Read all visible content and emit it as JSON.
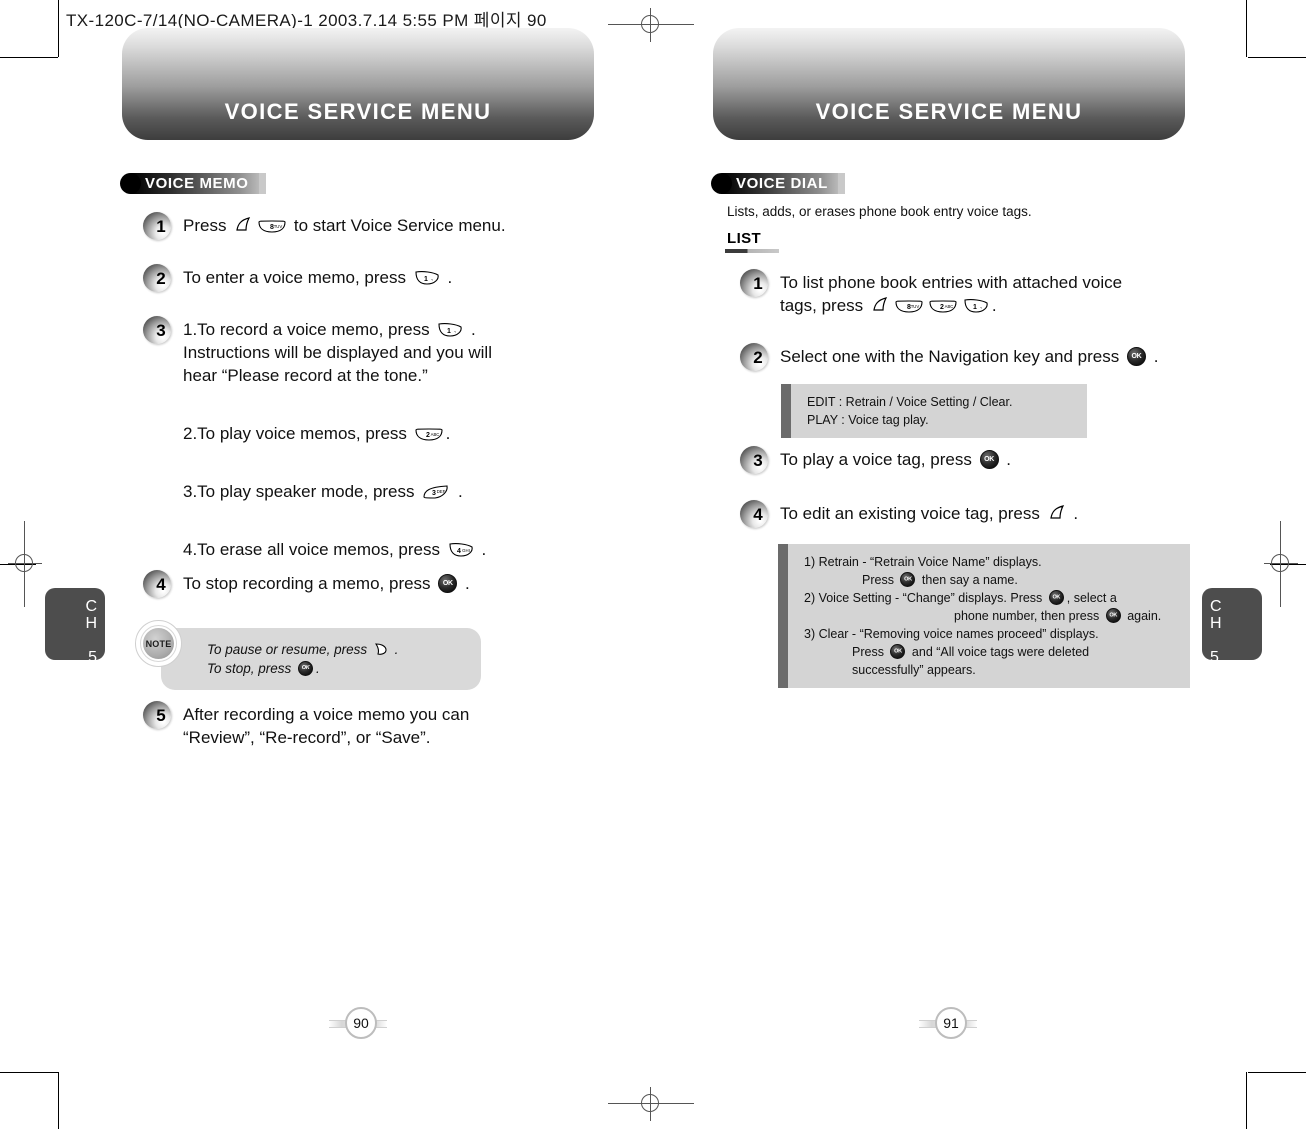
{
  "slug": "TX-120C-7/14(NO-CAMERA)-1  2003.7.14 5:55 PM 페이지 90",
  "left_page": {
    "banner_title": "VOICE SERVICE MENU",
    "section_badge": "VOICE MEMO",
    "chapter_tab": {
      "ch": "C",
      "h": "H",
      "number": "5"
    },
    "page_number": "90",
    "steps": [
      {
        "num": "1",
        "lines": [
          {
            "pre": "Press ",
            "keys": [
              "menu-key",
              "key-8-tuv"
            ],
            "post": " to start Voice Service menu."
          }
        ]
      },
      {
        "num": "2",
        "lines": [
          {
            "pre": "To enter a voice memo, press ",
            "keys": [
              "key-1"
            ],
            "post": " ."
          }
        ]
      },
      {
        "num": "3",
        "lines": [
          {
            "pre": "1.To record a voice memo, press ",
            "keys": [
              "key-1"
            ],
            "post": " ."
          },
          {
            "pre": "Instructions will be displayed and you will",
            "keys": [],
            "post": ""
          },
          {
            "pre": "hear “Please record at the tone.”",
            "keys": [],
            "post": ""
          },
          {
            "pre": "2.To play voice memos, press ",
            "keys": [
              "key-2-abc"
            ],
            "post": "."
          },
          {
            "pre": "3.To play speaker mode, press ",
            "keys": [
              "key-3-def"
            ],
            "post": " ."
          },
          {
            "pre": "4.To erase all voice memos, press ",
            "keys": [
              "key-4-ghi"
            ],
            "post": " ."
          }
        ]
      },
      {
        "num": "4",
        "lines": [
          {
            "pre": "To stop recording a memo, press ",
            "keys": [
              "ok-button"
            ],
            "post": " ."
          }
        ]
      },
      {
        "num": "5",
        "lines": [
          {
            "pre": "After recording a voice memo you can",
            "keys": [],
            "post": ""
          },
          {
            "pre": "“Review”, “Re-record”, or “Save”.",
            "keys": [],
            "post": ""
          }
        ]
      }
    ],
    "note": {
      "label": "NOTE",
      "line1_pre": "To pause or resume, press ",
      "line1_post": " .",
      "line2_pre": "To stop, press ",
      "line2_post": "."
    }
  },
  "right_page": {
    "banner_title": "VOICE SERVICE MENU",
    "section_badge": "VOICE DIAL",
    "subtitle": "Lists, adds, or erases phone book entry voice tags.",
    "sub_heading": "LIST",
    "chapter_tab": {
      "ch": "C",
      "h": "H",
      "number": "5"
    },
    "page_number": "91",
    "steps": [
      {
        "num": "1",
        "lines": [
          {
            "pre": "To list phone book entries with attached voice",
            "keys": [],
            "post": ""
          },
          {
            "pre": "tags, press ",
            "keys": [
              "menu-key",
              "key-8-tuv",
              "key-2-abc",
              "key-1"
            ],
            "post": "."
          }
        ]
      },
      {
        "num": "2",
        "lines": [
          {
            "pre": "Select one with the Navigation key and press ",
            "keys": [
              "ok-button"
            ],
            "post": " ."
          }
        ]
      },
      {
        "num": "3",
        "lines": [
          {
            "pre": "To play a voice tag, press ",
            "keys": [
              "ok-button"
            ],
            "post": " ."
          }
        ]
      },
      {
        "num": "4",
        "lines": [
          {
            "pre": "To edit an existing voice tag, press ",
            "keys": [
              "menu-key"
            ],
            "post": " ."
          }
        ]
      }
    ],
    "info_box_1": {
      "line1": "EDIT : Retrain / Voice Setting / Clear.",
      "line2": "PLAY : Voice tag play."
    },
    "info_box_2": {
      "l1": "1) Retrain - “Retrain Voice Name” displays.",
      "l2_pre": "Press ",
      "l2_post": " then say a name.",
      "l3_pre": "2) Voice Setting - “Change” displays. Press ",
      "l3_post": ", select a",
      "l4_pre": "phone number, then press ",
      "l4_post": " again.",
      "l5": "3) Clear - “Removing voice names proceed” displays.",
      "l6_pre": "Press ",
      "l6_post": " and “All voice tags were deleted",
      "l7": "successfully” appears."
    }
  }
}
